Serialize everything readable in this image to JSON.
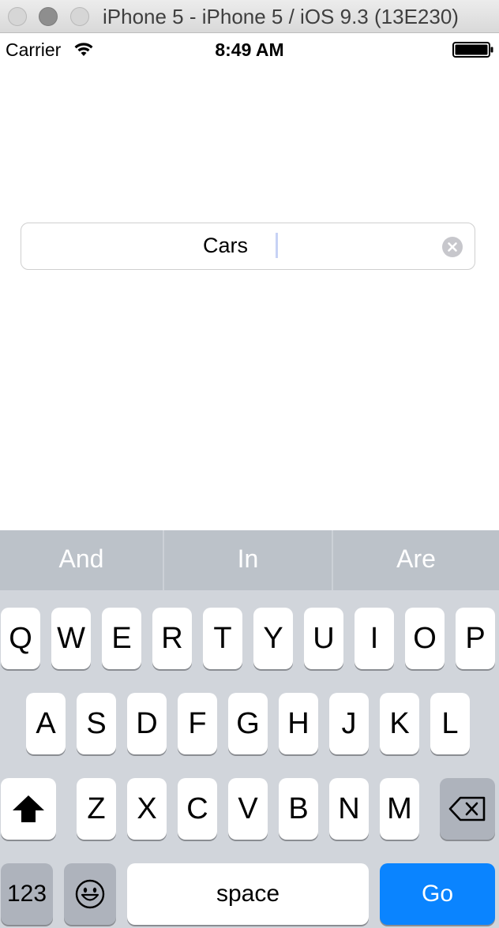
{
  "window": {
    "title": "iPhone 5 - iPhone 5 / iOS 9.3 (13E230)"
  },
  "status_bar": {
    "carrier": "Carrier",
    "time": "8:49 AM",
    "wifi_icon": "wifi-icon",
    "battery_icon": "battery-full-icon"
  },
  "text_field": {
    "value": "Cars",
    "clear_icon": "clear-circle-icon"
  },
  "keyboard": {
    "suggestions": [
      "And",
      "In",
      "Are"
    ],
    "row1": [
      "Q",
      "W",
      "E",
      "R",
      "T",
      "Y",
      "U",
      "I",
      "O",
      "P"
    ],
    "row2": [
      "A",
      "S",
      "D",
      "F",
      "G",
      "H",
      "J",
      "K",
      "L"
    ],
    "row3": [
      "Z",
      "X",
      "C",
      "V",
      "B",
      "N",
      "M"
    ],
    "shift_icon": "shift-arrow-icon",
    "delete_icon": "backspace-icon",
    "emoji_icon": "emoji-smiley-icon",
    "numbers_label": "123",
    "space_label": "space",
    "go_label": "Go",
    "colors": {
      "go_key": "#0a84ff",
      "key_bg": "#ffffff",
      "keyboard_bg": "#d1d5db",
      "predictive_bg": "#bcc2c9"
    }
  }
}
